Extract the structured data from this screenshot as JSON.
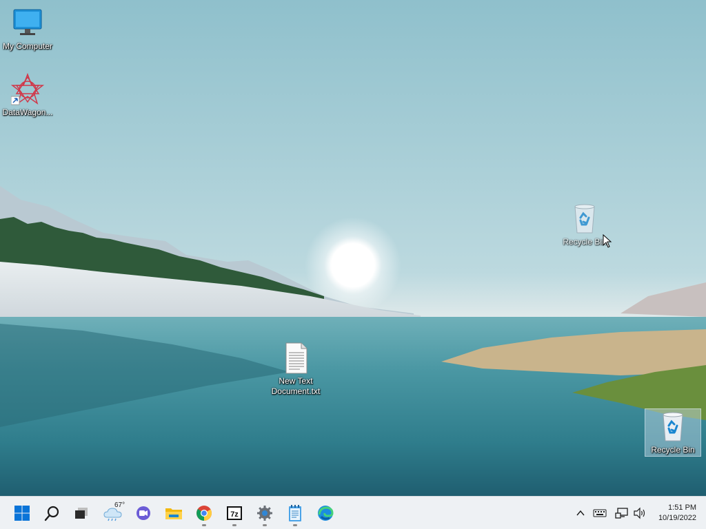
{
  "desktop": {
    "icons": [
      {
        "label": "My Computer",
        "icon": "monitor-icon"
      },
      {
        "label": "DataWagon...",
        "icon": "datawagon-shortcut-icon"
      },
      {
        "label": "Recycle Bin",
        "icon": "recycle-bin-icon"
      },
      {
        "label": "New Text Document.txt",
        "icon": "text-document-icon"
      },
      {
        "label": "Recycle Bin",
        "icon": "recycle-bin-icon"
      }
    ]
  },
  "taskbar": {
    "weather_temp": "67°",
    "apps": [
      {
        "name": "Start",
        "icon": "windows-start-icon"
      },
      {
        "name": "Search",
        "icon": "search-icon"
      },
      {
        "name": "Task View",
        "icon": "task-view-icon"
      },
      {
        "name": "Widgets",
        "icon": "weather-widget-icon"
      },
      {
        "name": "Chat",
        "icon": "chat-icon"
      },
      {
        "name": "File Explorer",
        "icon": "file-explorer-icon"
      },
      {
        "name": "Google Chrome",
        "icon": "chrome-icon"
      },
      {
        "name": "7-Zip",
        "icon": "7zip-icon"
      },
      {
        "name": "Settings",
        "icon": "settings-icon"
      },
      {
        "name": "Notepad",
        "icon": "notepad-icon"
      },
      {
        "name": "Microsoft Edge",
        "icon": "edge-icon"
      }
    ],
    "tray": {
      "icons": [
        "chevron-up-icon",
        "keyboard-icon",
        "network-icon",
        "volume-icon"
      ]
    },
    "clock": {
      "time": "1:51 PM",
      "date": "10/19/2022"
    }
  },
  "colors": {
    "accent": "#0067c0",
    "taskbar_bg": "#eef1f4"
  }
}
